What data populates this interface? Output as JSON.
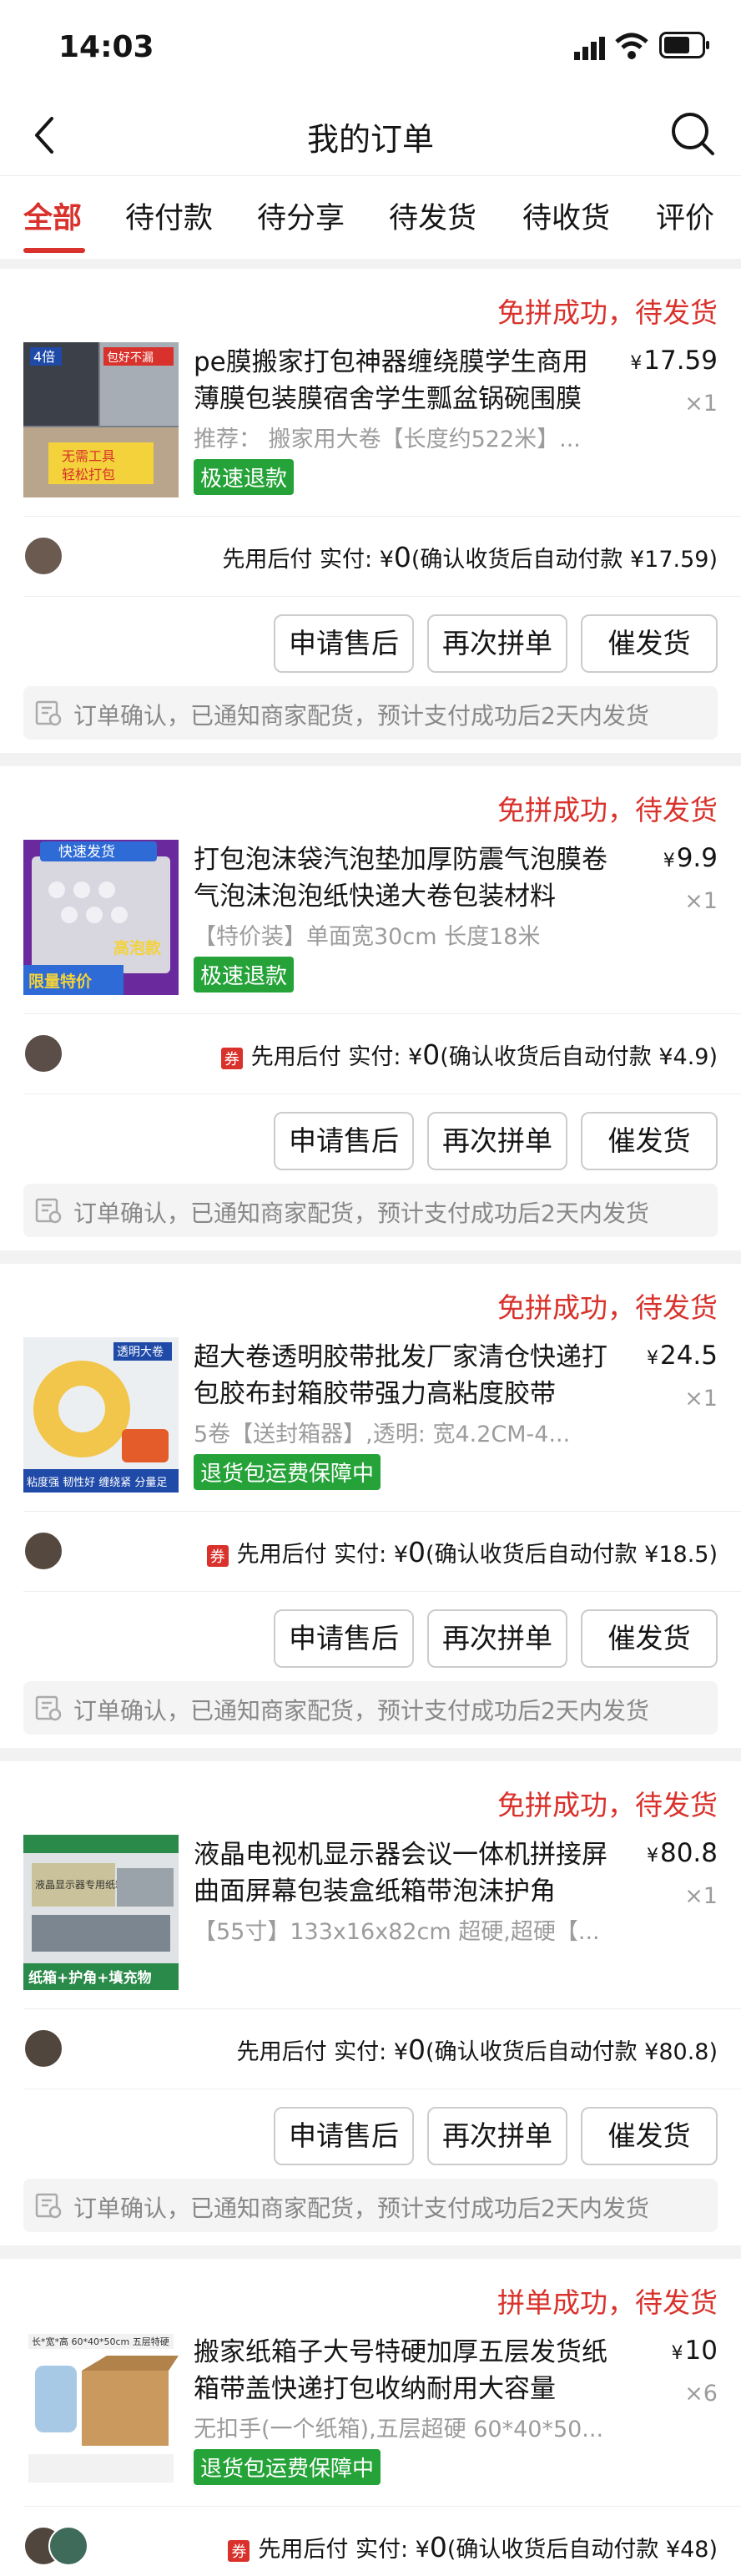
{
  "status_bar": {
    "time": "14:03"
  },
  "header": {
    "title": "我的订单"
  },
  "tabs": [
    {
      "label": "全部",
      "active": true
    },
    {
      "label": "待付款"
    },
    {
      "label": "待分享"
    },
    {
      "label": "待发货"
    },
    {
      "label": "待收货"
    },
    {
      "label": "评价"
    }
  ],
  "orders": [
    {
      "status": "免拼成功，待发货",
      "title": "pe膜搬家打包神器缠绕膜学生商用薄膜包装膜宿舍学生瓢盆锅碗围膜",
      "spec": "推荐： 搬家用大卷【长度约522米】...",
      "tag": "极速退款",
      "price": "17.59",
      "qty": "×1",
      "pay_label": "先用后付 实付:",
      "pay_amount": "0",
      "pay_note": "(确认收货后自动付款 ¥17.59)",
      "buttons": [
        "申请售后",
        "再次拼单",
        "催发货"
      ],
      "notice": "订单确认，已通知商家配货，预计支付成功后2天内发货",
      "thumb_text": [
        "4倍",
        "包好不漏",
        "无需工具",
        "轻松打包"
      ]
    },
    {
      "status": "免拼成功，待发货",
      "title": "打包泡沫袋汽泡垫加厚防震气泡膜卷气泡沫泡泡纸快递大卷包装材料",
      "spec": "【特价装】单面宽30cm 长度18米",
      "tag": "极速退款",
      "price": "9.9",
      "qty": "×1",
      "coupon": "券",
      "pay_label": "先用后付 实付:",
      "pay_amount": "0",
      "pay_note": "(确认收货后自动付款 ¥4.9)",
      "buttons": [
        "申请售后",
        "再次拼单",
        "催发货"
      ],
      "notice": "订单确认，已通知商家配货，预计支付成功后2天内发货",
      "thumb_text": [
        "快速发货",
        "高泡款",
        "限量特价"
      ]
    },
    {
      "status": "免拼成功，待发货",
      "title": "超大卷透明胶带批发厂家清仓快递打包胶布封箱胶带强力高粘度胶带",
      "spec": "5卷【送封箱器】,透明: 宽4.2CM-4...",
      "tag": "退货包运费保障中",
      "price": "24.5",
      "qty": "×1",
      "coupon": "券",
      "pay_label": "先用后付 实付:",
      "pay_amount": "0",
      "pay_note": "(确认收货后自动付款 ¥18.5)",
      "buttons": [
        "申请售后",
        "再次拼单",
        "催发货"
      ],
      "notice": "订单确认，已通知商家配货，预计支付成功后2天内发货",
      "thumb_text": [
        "透明大卷",
        "粘度强 韧性好 缠绕紧 分量足"
      ]
    },
    {
      "status": "免拼成功，待发货",
      "title": "液晶电视机显示器会议一体机拼接屏曲面屏幕包装盒纸箱带泡沫护角",
      "spec": "【55寸】133x16x82cm 超硬,超硬【...",
      "tag": "",
      "price": "80.8",
      "qty": "×1",
      "pay_label": "先用后付 实付:",
      "pay_amount": "0",
      "pay_note": "(确认收货后自动付款 ¥80.8)",
      "buttons": [
        "申请售后",
        "再次拼单",
        "催发货"
      ],
      "notice": "订单确认，已通知商家配货，预计支付成功后2天内发货",
      "thumb_text": [
        "液晶显示器专用纸箱",
        "纸箱+护角+填充物"
      ]
    },
    {
      "status": "拼单成功，待发货",
      "title": "搬家纸箱子大号特硬加厚五层发货纸箱带盖快递打包收纳耐用大容量",
      "spec": "无扣手(一个纸箱),五层超硬 60*40*50...",
      "tag": "退货包运费保障中",
      "price": "10",
      "qty": "×6",
      "coupon": "券",
      "pay_label": "先用后付 实付:",
      "pay_amount": "0",
      "pay_note": "(确认收货后自动付款 ¥48)",
      "thumb_text": [
        "长*宽*高 60*40*50cm 五层特硬"
      ]
    }
  ]
}
